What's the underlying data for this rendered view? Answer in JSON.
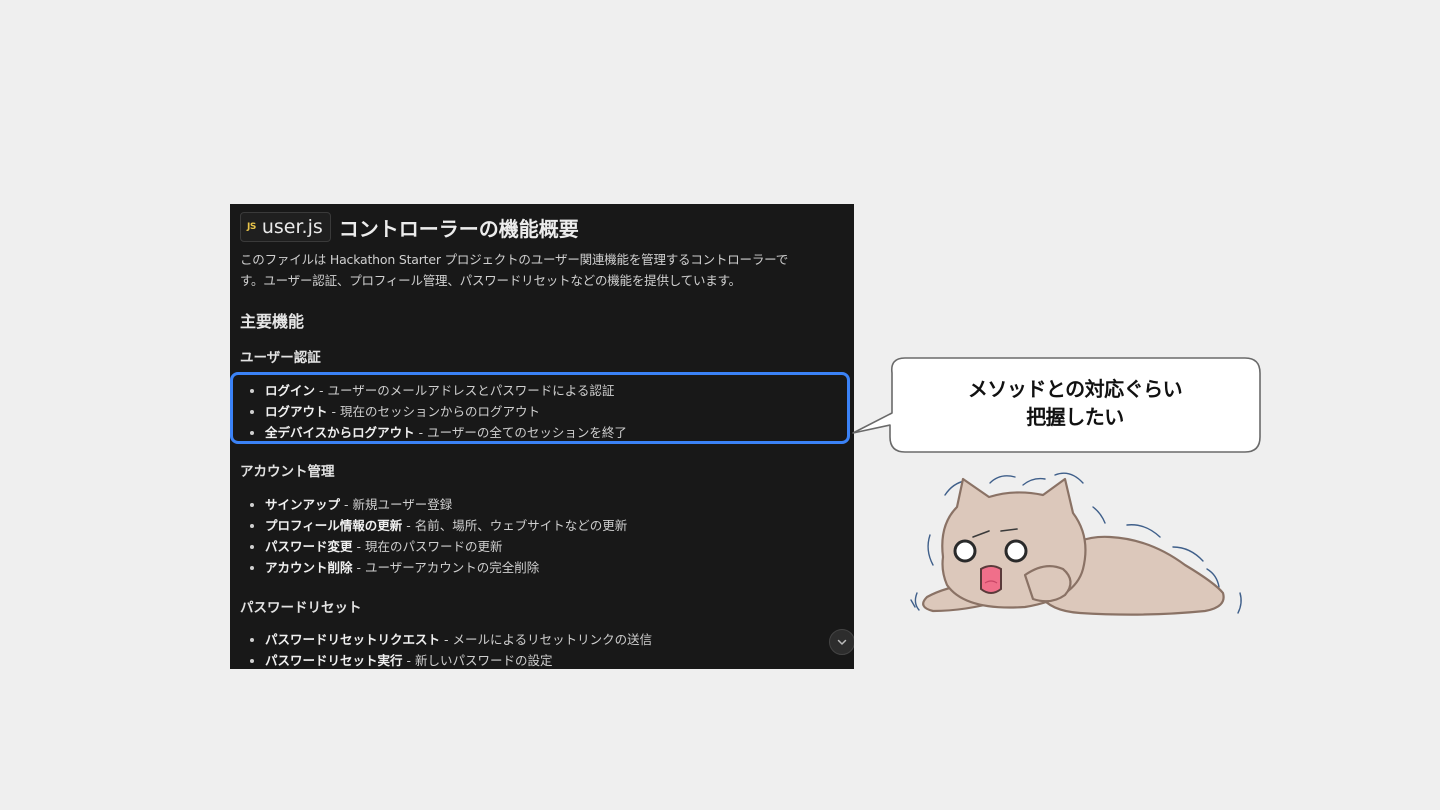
{
  "document": {
    "file_chip": {
      "icon_label": "JS",
      "file_name": "user.js"
    },
    "title": "コントローラーの機能概要",
    "intro_line1": "このファイルは Hackathon Starter プロジェクトのユーザー関連機能を管理するコントローラーで",
    "intro_line2": "す。ユーザー認証、プロフィール管理、パスワードリセットなどの機能を提供しています。",
    "main_heading": "主要機能",
    "sections": [
      {
        "heading": "ユーザー認証",
        "items": [
          {
            "title": "ログイン",
            "desc": " - ユーザーのメールアドレスとパスワードによる認証"
          },
          {
            "title": "ログアウト",
            "desc": " - 現在のセッションからのログアウト"
          },
          {
            "title": "全デバイスからログアウト",
            "desc": " - ユーザーの全てのセッションを終了"
          }
        ]
      },
      {
        "heading": "アカウント管理",
        "items": [
          {
            "title": "サインアップ",
            "desc": " - 新規ユーザー登録"
          },
          {
            "title": "プロフィール情報の更新",
            "desc": " - 名前、場所、ウェブサイトなどの更新"
          },
          {
            "title": "パスワード変更",
            "desc": " - 現在のパスワードの更新"
          },
          {
            "title": "アカウント削除",
            "desc": " - ユーザーアカウントの完全削除"
          }
        ]
      },
      {
        "heading": "パスワードリセット",
        "items": [
          {
            "title": "パスワードリセットリクエスト",
            "desc": " - メールによるリセットリンクの送信"
          },
          {
            "title": "パスワードリセット実行",
            "desc": " - 新しいパスワードの設定"
          }
        ]
      }
    ],
    "scroll_icon": "chevron-down-icon"
  },
  "callout": {
    "line1": "メソッドとの対応ぐらい",
    "line2": "把握したい"
  },
  "colors": {
    "background": "#efefef",
    "panel": "#181818",
    "highlight": "#3b82f6",
    "js_icon": "#e8c44a",
    "cat_fill": "#dcc8bb"
  }
}
